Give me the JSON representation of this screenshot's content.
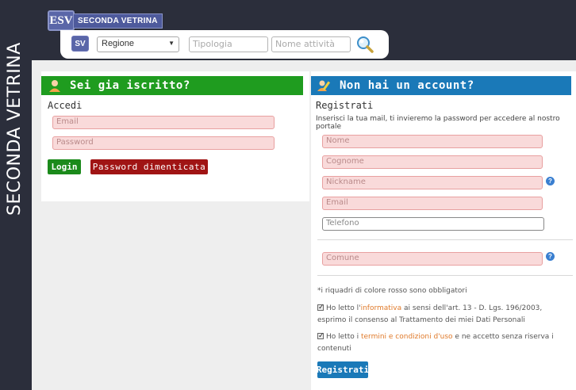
{
  "header": {
    "logo_mark": "ESV",
    "logo_text": "SECONDA VETRINA",
    "searchbar_logo": "SV",
    "region_select": "Regione",
    "tipologia_placeholder": "Tipologia",
    "nome_placeholder": "Nome attività",
    "search_icon": "magnifier-icon"
  },
  "side_brand": "SECONDA VETRINA",
  "login": {
    "title": "Sei gia iscritto?",
    "subtitle": "Accedi",
    "email_placeholder": "Email",
    "password_placeholder": "Password",
    "login_button": "Login",
    "forgot_button": "Password dimenticata"
  },
  "register": {
    "title": "Non hai un account?",
    "subtitle": "Registrati",
    "description": "Inserisci la tua mail, ti invieremo la password per accedere al nostro portale",
    "nome_placeholder": "Nome",
    "cognome_placeholder": "Cognome",
    "nickname_placeholder": "Nickname",
    "email_placeholder": "Email",
    "telefono_placeholder": "Telefono",
    "comune_placeholder": "Comune",
    "help_label": "?",
    "required_note": "*i riquadri di colore rosso sono obbligatori",
    "consent1_pre": "Ho letto l'",
    "consent1_link": "informativa",
    "consent1_post": " ai sensi dell'art. 13 - D. Lgs. 196/2003, esprimo il consenso al Trattamento dei miei Dati Personali",
    "consent2_pre": "Ho letto i ",
    "consent2_link": "termini e condizioni d'uso",
    "consent2_post": " e ne accetto senza riserva i contenuti",
    "submit_button": "Registrati"
  },
  "colors": {
    "dark_bg": "#2b2e3b",
    "green": "#1f9c1f",
    "blue": "#1a79b8",
    "required_field": "#f9dada",
    "danger": "#a01414"
  }
}
